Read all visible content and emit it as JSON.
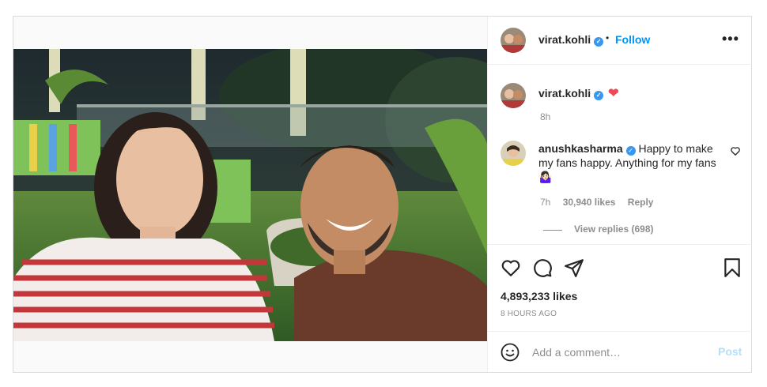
{
  "post": {
    "username": "virat.kohli",
    "follow_label": "Follow",
    "separator": "•",
    "more_label": "•••",
    "caption": {
      "username": "virat.kohli",
      "emoji": "❤",
      "time": "8h"
    },
    "comment": {
      "username": "anushkasharma",
      "text": "Happy to make my fans happy. Anything for my fans 🤷🏻‍♀️",
      "time": "7h",
      "likes": "30,940 likes",
      "reply_label": "Reply",
      "view_replies": "View replies (698)"
    },
    "likes_count": "4,893,233 likes",
    "posted_ago": "8 HOURS AGO",
    "comment_box": {
      "placeholder": "Add a comment…",
      "post_label": "Post"
    },
    "verified_glyph": "✓",
    "icons": [
      "heart-icon",
      "comment-icon",
      "share-icon",
      "bookmark-icon",
      "emoji-icon",
      "more-icon",
      "verified-icon"
    ],
    "colors": {
      "follow": "#0095f6",
      "verified": "#3897f0",
      "heart": "#ed4956",
      "post_disabled": "#b2dffc",
      "muted": "#8e8e8e"
    }
  }
}
